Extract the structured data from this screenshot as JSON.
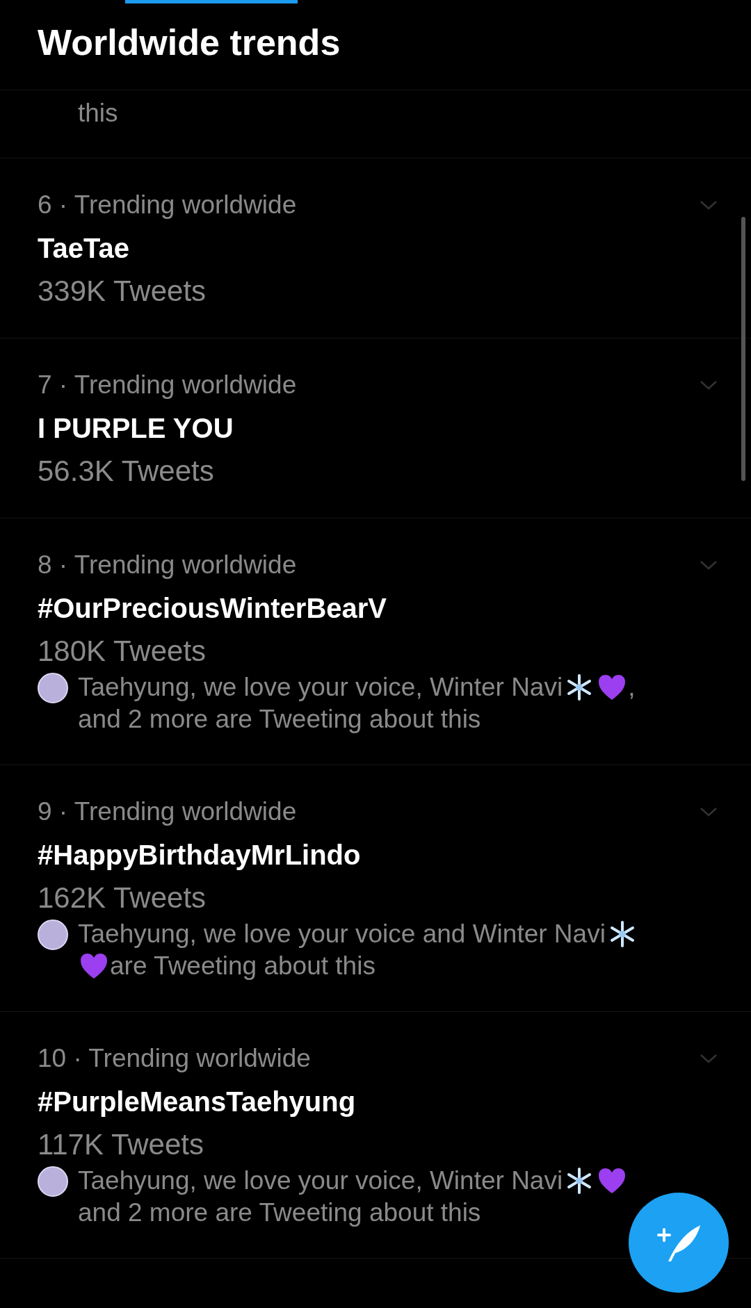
{
  "header": {
    "title": "Worldwide trends"
  },
  "partial_trend": {
    "social_tail": "this"
  },
  "trends": [
    {
      "context": "6 · Trending worldwide",
      "name": "TaeTae",
      "count": "339K Tweets"
    },
    {
      "context": "7 · Trending worldwide",
      "name": "I PURPLE YOU",
      "count": "56.3K Tweets"
    },
    {
      "context": "8 · Trending worldwide",
      "name": "#OurPreciousWinterBearV",
      "count": "180K Tweets",
      "social": [
        {
          "kind": "text",
          "text": "Taehyung, we love your voice, Winter Navi"
        },
        {
          "kind": "snowflake"
        },
        {
          "kind": "heart"
        },
        {
          "kind": "text",
          "text": ","
        },
        {
          "kind": "break"
        },
        {
          "kind": "text",
          "text": "and 2 more are Tweeting about this"
        }
      ]
    },
    {
      "context": "9 · Trending worldwide",
      "name": "#HappyBirthdayMrLindo",
      "count": "162K Tweets",
      "social": [
        {
          "kind": "text",
          "text": "Taehyung, we love your voice and Winter Navi"
        },
        {
          "kind": "snowflake"
        },
        {
          "kind": "break"
        },
        {
          "kind": "heart"
        },
        {
          "kind": "text",
          "text": "are Tweeting about this"
        }
      ]
    },
    {
      "context": "10 · Trending worldwide",
      "name": "#PurpleMeansTaehyung",
      "count": "117K Tweets",
      "social": [
        {
          "kind": "text",
          "text": "Taehyung, we love your voice, Winter Navi"
        },
        {
          "kind": "snowflake"
        },
        {
          "kind": "heart"
        },
        {
          "kind": "break"
        },
        {
          "kind": "text",
          "text": "and 2 more are Tweeting about this"
        }
      ]
    }
  ]
}
